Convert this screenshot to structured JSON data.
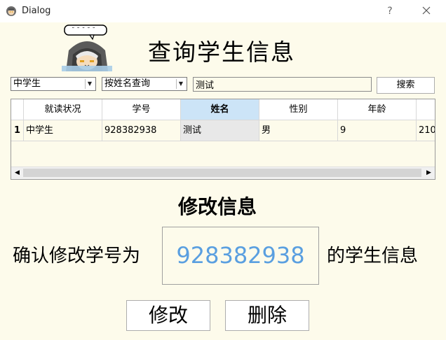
{
  "window": {
    "title": "Dialog",
    "help_label": "?"
  },
  "page": {
    "title": "查询学生信息"
  },
  "search": {
    "status_filter": "中学生",
    "mode_filter": "按姓名查询",
    "query_value": "测试",
    "button_label": "搜索"
  },
  "table": {
    "columns": [
      "就读状况",
      "学号",
      "姓名",
      "性别",
      "年龄",
      "210"
    ],
    "header_labels": [
      "就读状况",
      "学号",
      "姓名",
      "性别",
      "年龄"
    ],
    "active_column": "姓名",
    "rows": [
      {
        "index": "1",
        "cells": [
          "中学生",
          "928382938",
          "测试",
          "男",
          "9",
          "210"
        ]
      }
    ]
  },
  "edit": {
    "section_title": "修改信息",
    "confirm_prefix": "确认修改学号为",
    "student_id": "928382938",
    "confirm_suffix": "的学生信息",
    "modify_label": "修改",
    "delete_label": "删除"
  },
  "colors": {
    "background": "#fdfbeb",
    "accent_id": "#5a9fe0",
    "selected_header": "#cce4f7"
  }
}
